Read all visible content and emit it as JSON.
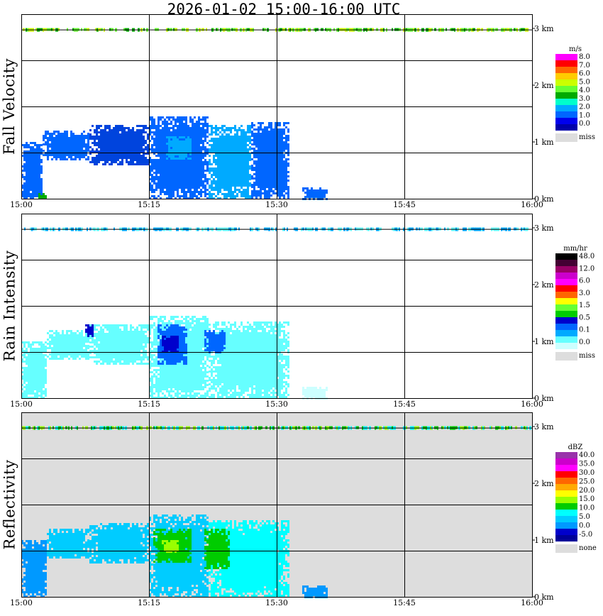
{
  "title": "2026-01-02  15:00-16:00 UTC",
  "chart_data": [
    {
      "type": "heatmap",
      "ylabel": "Fall Velocity",
      "x_ticks": [
        "15:00",
        "15:15",
        "15:30",
        "15:45",
        "16:00"
      ],
      "x_range": [
        "15:00",
        "16:00"
      ],
      "y_ticks": [
        "0 km",
        "1 km",
        "2 km",
        "3 km"
      ],
      "ylim_km": [
        0,
        3
      ],
      "colorbar": {
        "unit": "m/s",
        "labels": [
          "8.0",
          "7.0",
          "6.0",
          "5.0",
          "4.0",
          "3.0",
          "2.0",
          "1.0",
          "0.0",
          "miss"
        ],
        "colors": [
          "#ff00ff",
          "#ff0000",
          "#ff6600",
          "#ffcc00",
          "#ccff00",
          "#66ff33",
          "#00aa00",
          "#00ffcc",
          "#00aaff",
          "#0066ff",
          "#0000ee",
          "#0000aa"
        ],
        "miss_color": "#dddddd"
      },
      "background": "#ffffff",
      "regions": [
        {
          "t0": 0.0,
          "t1": 2.5,
          "h0": 0.0,
          "h1": 1.0,
          "color": "#0066ff"
        },
        {
          "t0": 2.5,
          "t1": 8.0,
          "h0": 0.7,
          "h1": 1.2,
          "color": "#0066ff"
        },
        {
          "t0": 8.0,
          "t1": 15.0,
          "h0": 0.6,
          "h1": 1.3,
          "color": "#0044dd"
        },
        {
          "t0": 15.0,
          "t1": 22.0,
          "h0": 0.0,
          "h1": 1.45,
          "color": "#0066ff"
        },
        {
          "t0": 22.0,
          "t1": 27.0,
          "h0": 0.0,
          "h1": 1.3,
          "color": "#00aaff"
        },
        {
          "t0": 27.0,
          "t1": 31.5,
          "h0": 0.0,
          "h1": 1.35,
          "color": "#0066ff"
        },
        {
          "t0": 33.0,
          "t1": 36.0,
          "h0": 0.0,
          "h1": 0.2,
          "color": "#0066ff"
        },
        {
          "t0": 17.0,
          "t1": 20.0,
          "h0": 0.7,
          "h1": 1.1,
          "color": "#00aaff"
        },
        {
          "t0": 2.0,
          "t1": 3.0,
          "h0": 0.0,
          "h1": 0.1,
          "color": "#00aa00"
        }
      ],
      "top_band": {
        "height_km": 2.98,
        "colors": [
          "#66ff33",
          "#00aa00",
          "#ccff00"
        ]
      }
    },
    {
      "type": "heatmap",
      "ylabel": "Rain Intensity",
      "x_ticks": [
        "15:00",
        "15:15",
        "15:30",
        "15:45",
        "16:00"
      ],
      "x_range": [
        "15:00",
        "16:00"
      ],
      "y_ticks": [
        "0 km",
        "1 km",
        "2 km",
        "3 km"
      ],
      "ylim_km": [
        0,
        3
      ],
      "colorbar": {
        "unit": "mm/hr",
        "labels": [
          "48.0",
          "12.0",
          "6.0",
          "3.0",
          "1.5",
          "0.5",
          "0.1",
          "0.0",
          "miss"
        ],
        "colors": [
          "#000000",
          "#440033",
          "#990066",
          "#cc00cc",
          "#ff00ff",
          "#ff0000",
          "#ff6600",
          "#ffff00",
          "#66ff33",
          "#00cc00",
          "#0000cc",
          "#0066ff",
          "#00aaff",
          "#66ffff",
          "#ccffff"
        ],
        "miss_color": "#dddddd"
      },
      "background": "#ffffff",
      "regions": [
        {
          "t0": 0.0,
          "t1": 3.0,
          "h0": 0.0,
          "h1": 1.0,
          "color": "#66ffff"
        },
        {
          "t0": 3.0,
          "t1": 8.0,
          "h0": 0.7,
          "h1": 1.2,
          "color": "#66ffff"
        },
        {
          "t0": 8.0,
          "t1": 15.0,
          "h0": 0.6,
          "h1": 1.3,
          "color": "#66ffff"
        },
        {
          "t0": 15.0,
          "t1": 22.0,
          "h0": 0.0,
          "h1": 1.45,
          "color": "#66ffff"
        },
        {
          "t0": 22.0,
          "t1": 31.5,
          "h0": 0.0,
          "h1": 1.35,
          "color": "#66ffff"
        },
        {
          "t0": 33.0,
          "t1": 36.0,
          "h0": 0.0,
          "h1": 0.2,
          "color": "#ccffff"
        },
        {
          "t0": 16.0,
          "t1": 19.5,
          "h0": 0.6,
          "h1": 1.3,
          "color": "#0066ff"
        },
        {
          "t0": 16.5,
          "t1": 18.5,
          "h0": 0.8,
          "h1": 1.1,
          "color": "#0000cc"
        },
        {
          "t0": 21.5,
          "t1": 24.0,
          "h0": 0.8,
          "h1": 1.2,
          "color": "#0066ff"
        },
        {
          "t0": 7.5,
          "t1": 8.5,
          "h0": 1.1,
          "h1": 1.3,
          "color": "#0000cc"
        }
      ],
      "top_band": {
        "height_km": 2.98,
        "colors": [
          "#66ffff",
          "#00aaff"
        ]
      }
    },
    {
      "type": "heatmap",
      "ylabel": "Reflectivity",
      "x_ticks": [
        "15:00",
        "15:15",
        "15:30",
        "15:45",
        "16:00"
      ],
      "x_range": [
        "15:00",
        "16:00"
      ],
      "y_ticks": [
        "0 km",
        "1 km",
        "2 km",
        "3 km"
      ],
      "ylim_km": [
        0,
        3
      ],
      "colorbar": {
        "unit": "dBZ",
        "labels": [
          "40.0",
          "35.0",
          "30.0",
          "25.0",
          "20.0",
          "15.0",
          "10.0",
          "5.0",
          "0.0",
          "-5.0",
          "none"
        ],
        "colors": [
          "#9933aa",
          "#cc00cc",
          "#ff00ff",
          "#ff0000",
          "#ff6600",
          "#ffaa00",
          "#ffff00",
          "#99ff00",
          "#00cc00",
          "#00ffff",
          "#00ccff",
          "#0099ff",
          "#0000cc",
          "#000099"
        ],
        "miss_color": "#dddddd"
      },
      "background": "#dddddd",
      "regions": [
        {
          "t0": 0.0,
          "t1": 3.0,
          "h0": 0.0,
          "h1": 1.0,
          "color": "#0099ff"
        },
        {
          "t0": 3.0,
          "t1": 8.0,
          "h0": 0.7,
          "h1": 1.2,
          "color": "#00ccff"
        },
        {
          "t0": 8.0,
          "t1": 15.0,
          "h0": 0.6,
          "h1": 1.3,
          "color": "#00ccff"
        },
        {
          "t0": 15.0,
          "t1": 22.0,
          "h0": 0.0,
          "h1": 1.45,
          "color": "#00ccff"
        },
        {
          "t0": 22.0,
          "t1": 31.5,
          "h0": 0.0,
          "h1": 1.35,
          "color": "#00ffff"
        },
        {
          "t0": 33.0,
          "t1": 36.0,
          "h0": 0.0,
          "h1": 0.2,
          "color": "#0099ff"
        },
        {
          "t0": 15.5,
          "t1": 20.0,
          "h0": 0.6,
          "h1": 1.2,
          "color": "#00cc00"
        },
        {
          "t0": 21.5,
          "t1": 24.5,
          "h0": 0.5,
          "h1": 1.2,
          "color": "#00cc00"
        },
        {
          "t0": 16.5,
          "t1": 18.5,
          "h0": 0.8,
          "h1": 1.0,
          "color": "#99ff00"
        }
      ],
      "top_band": {
        "height_km": 2.98,
        "colors": [
          "#00cc00",
          "#00ffff",
          "#99ff00"
        ]
      }
    }
  ]
}
